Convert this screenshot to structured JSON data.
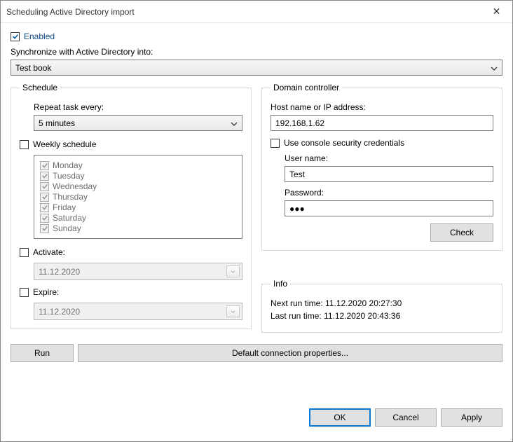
{
  "window": {
    "title": "Scheduling Active Directory import",
    "close": "✕"
  },
  "enabled": {
    "label": "Enabled",
    "checked": true
  },
  "syncLabel": "Synchronize with Active Directory into:",
  "syncTarget": "Test book",
  "schedule": {
    "legend": "Schedule",
    "repeatLabel": "Repeat task every:",
    "repeatValue": "5 minutes",
    "weekly": {
      "label": "Weekly schedule",
      "checked": false,
      "days": [
        "Monday",
        "Tuesday",
        "Wednesday",
        "Thursday",
        "Friday",
        "Saturday",
        "Sunday"
      ]
    },
    "activate": {
      "label": "Activate:",
      "checked": false,
      "value": "11.12.2020"
    },
    "expire": {
      "label": "Expire:",
      "checked": false,
      "value": "11.12.2020"
    }
  },
  "dc": {
    "legend": "Domain controller",
    "hostLabel": "Host name or IP address:",
    "hostValue": "192.168.1.62",
    "useConsole": {
      "label": "Use console security credentials",
      "checked": false
    },
    "userLabel": "User name:",
    "userValue": "Test",
    "passLabel": "Password:",
    "passValue": "●●●",
    "checkBtn": "Check"
  },
  "info": {
    "legend": "Info",
    "next": "Next run time: 11.12.2020 20:27:30",
    "last": "Last run time: 11.12.2020 20:43:36"
  },
  "buttons": {
    "run": "Run",
    "defaultConn": "Default connection properties...",
    "ok": "OK",
    "cancel": "Cancel",
    "apply": "Apply"
  }
}
